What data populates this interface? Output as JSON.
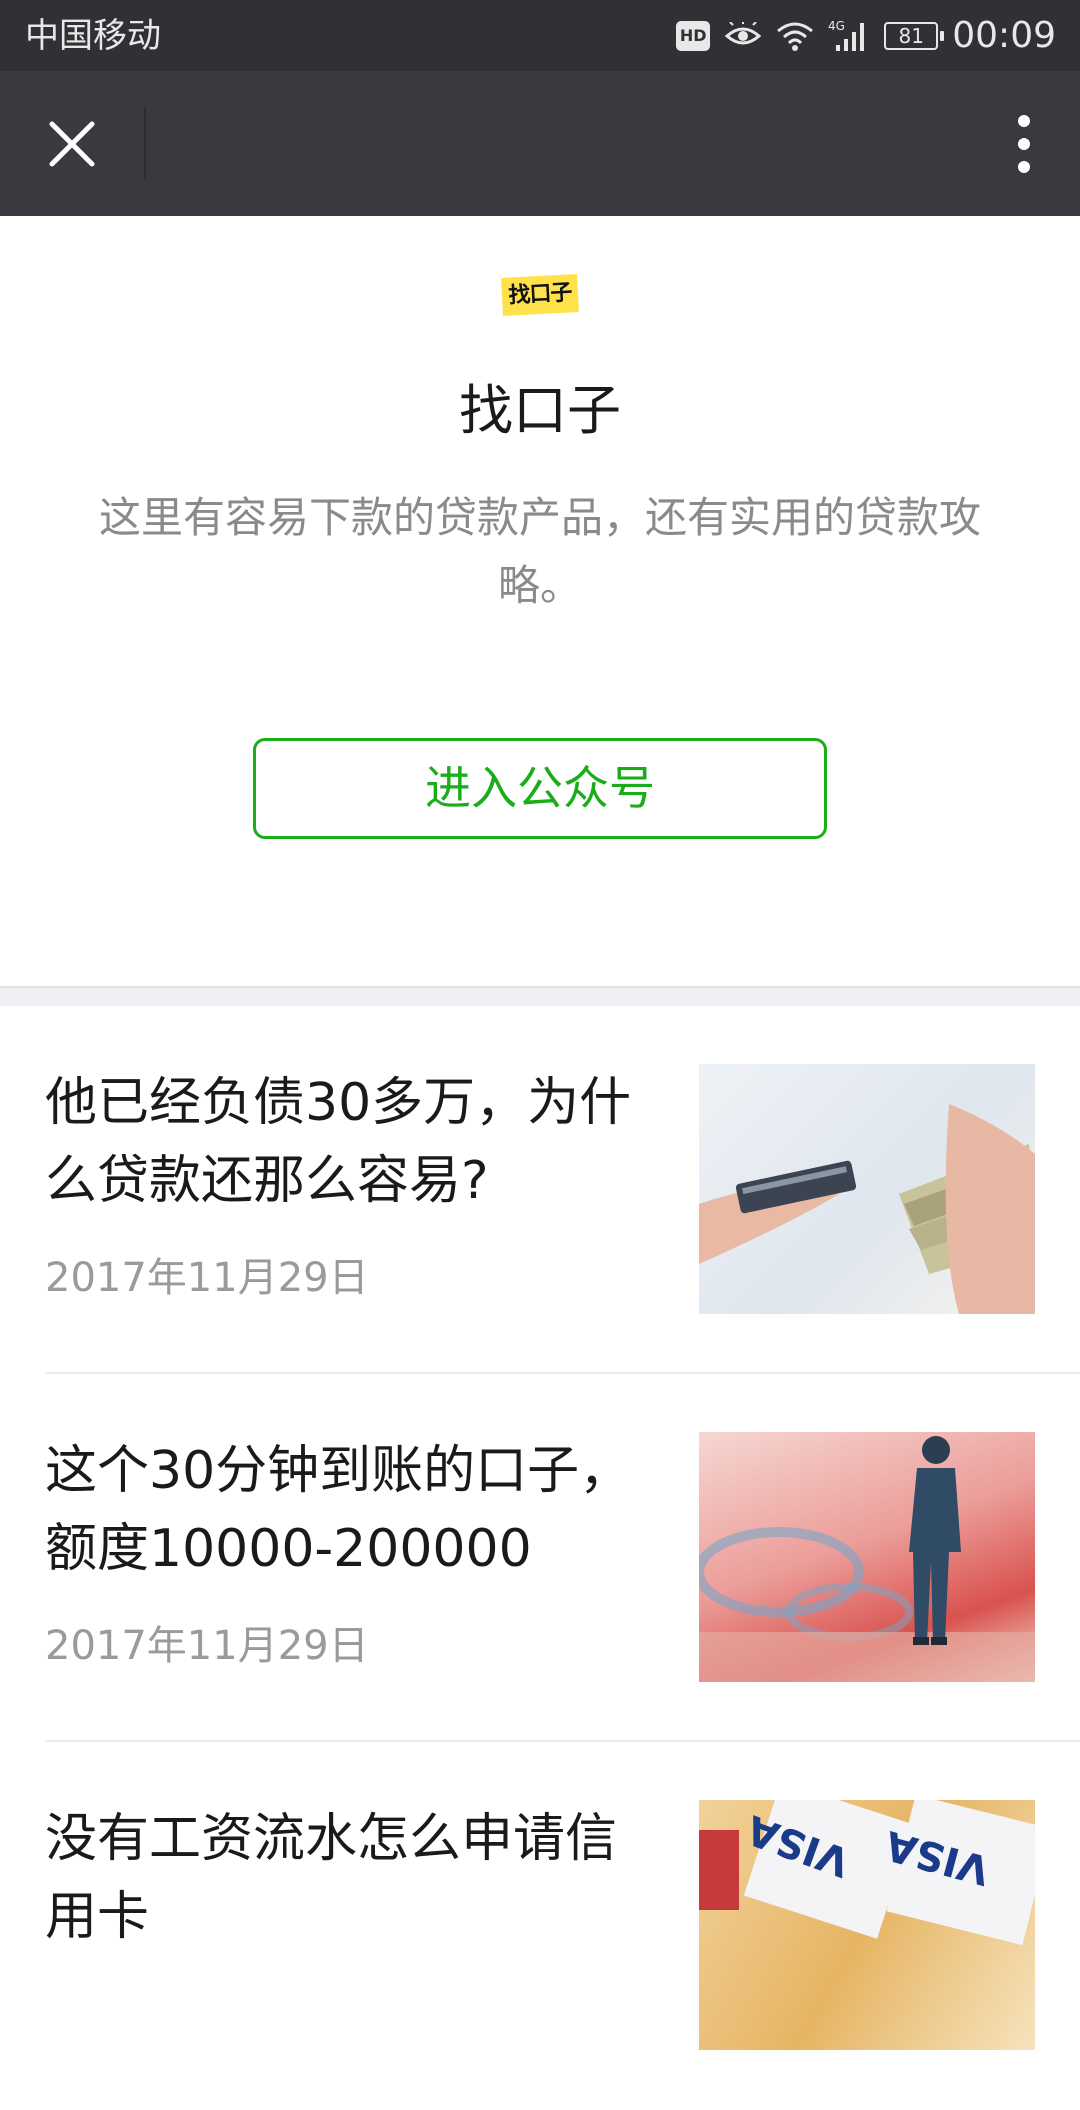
{
  "status_bar": {
    "carrier": "中国移动",
    "hd_badge": "HD",
    "network": "4G",
    "battery": "81",
    "time": "00:09"
  },
  "title_bar": {
    "close_icon": "close-icon",
    "more_icon": "more-vertical-icon"
  },
  "profile": {
    "logo_text": "找口子",
    "name": "找口子",
    "description": "这里有容易下款的贷款产品，还有实用的贷款攻略。",
    "enter_button": "进入公众号",
    "accent_color": "#1aad19"
  },
  "articles": [
    {
      "title": "他已经负债30多万，为什么贷款还那么容易?",
      "date": "2017年11月29日",
      "thumbnail": "hands-card-cash-image"
    },
    {
      "title": "这个30分钟到账的口子，额度10000-200000",
      "date": "2017年11月29日",
      "thumbnail": "businessman-figure-on-banknotes-image"
    },
    {
      "title": "没有工资流水怎么申请信用卡",
      "date": "",
      "thumbnail": "visa-cards-image"
    }
  ]
}
